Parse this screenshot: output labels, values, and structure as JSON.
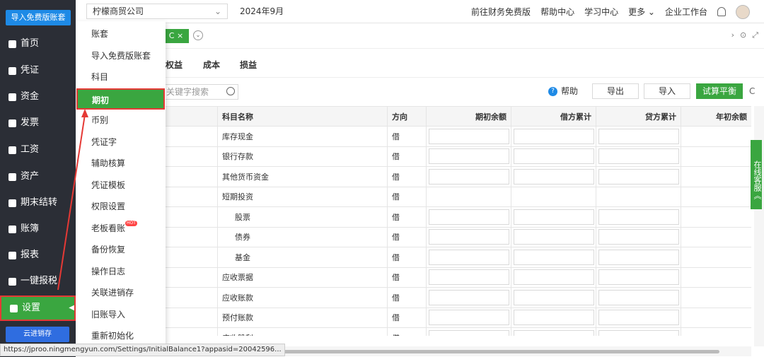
{
  "sidebar": {
    "promo_label": "导入免费版账套",
    "items": [
      {
        "label": "首页"
      },
      {
        "label": "凭证"
      },
      {
        "label": "资金"
      },
      {
        "label": "发票"
      },
      {
        "label": "工资"
      },
      {
        "label": "资产"
      },
      {
        "label": "期末结转"
      },
      {
        "label": "账簿"
      },
      {
        "label": "报表"
      },
      {
        "label": "一键报税"
      },
      {
        "label": "设置"
      }
    ],
    "bottom_badge": "云进销存"
  },
  "header": {
    "company": "柠檬商贸公司",
    "period": "2024年9月",
    "links": [
      "前往财务免费版",
      "帮助中心",
      "学习中心",
      "更多",
      "企业工作台"
    ]
  },
  "tabs": {
    "active_close": "C ×"
  },
  "subtabs": [
    "权益",
    "成本",
    "损益"
  ],
  "toolbar": {
    "search_placeholder": "关键字搜索",
    "help": "帮助",
    "export": "导出",
    "import": "导入",
    "trial_balance": "试算平衡"
  },
  "table": {
    "headers": [
      "科目名称",
      "方向",
      "期初余额",
      "借方累计",
      "贷方累计",
      "年初余额"
    ],
    "rows": [
      {
        "name": "库存现金",
        "dir": "借",
        "inputs": true
      },
      {
        "name": "银行存款",
        "dir": "借",
        "inputs": true
      },
      {
        "name": "其他货币资金",
        "dir": "借",
        "inputs": true
      },
      {
        "name": "短期投资",
        "dir": "借",
        "inputs": false
      },
      {
        "name": "股票",
        "dir": "借",
        "inputs": true,
        "indent": true
      },
      {
        "name": "债券",
        "dir": "借",
        "inputs": true,
        "indent": true
      },
      {
        "name": "基金",
        "dir": "借",
        "inputs": true,
        "indent": true
      },
      {
        "name": "应收票据",
        "dir": "借",
        "inputs": true
      },
      {
        "name": "应收账款",
        "dir": "借",
        "inputs": true
      },
      {
        "name": "预付账款",
        "dir": "借",
        "inputs": true
      },
      {
        "name": "应收股利",
        "dir": "借",
        "inputs": true
      }
    ]
  },
  "menu": {
    "items": [
      "账套",
      "导入免费版账套",
      "科目",
      "期初",
      "币别",
      "凭证字",
      "辅助核算",
      "凭证模板",
      "权限设置",
      "老板看账",
      "备份恢复",
      "操作日志",
      "关联进销存",
      "旧账导入",
      "重新初始化"
    ],
    "active": "期初",
    "hot_label": "HOT"
  },
  "service": "在线客服《",
  "status_url": "https://jproo.ningmengyun.com/Settings/InitialBalance1?appasid=20042596..."
}
